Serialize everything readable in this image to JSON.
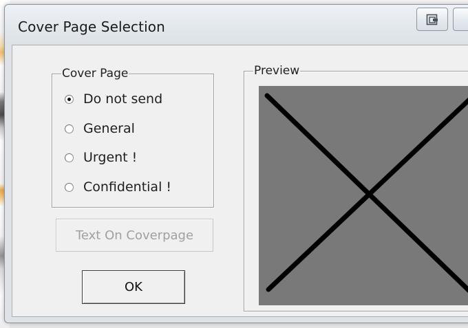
{
  "window": {
    "title": "Cover Page Selection",
    "titlebar_buttons": [
      {
        "icon": "restore-icon"
      },
      {
        "icon": "maximize-icon"
      }
    ]
  },
  "cover_page": {
    "legend": "Cover Page",
    "options": [
      {
        "label": "Do not send",
        "checked": true
      },
      {
        "label": "General",
        "checked": false
      },
      {
        "label": "Urgent !",
        "checked": false
      },
      {
        "label": "Confidential !",
        "checked": false
      }
    ]
  },
  "buttons": {
    "text_on_coverpage": "Text On Coverpage",
    "text_on_coverpage_enabled": false,
    "ok": "OK"
  },
  "preview": {
    "legend": "Preview",
    "placeholder_icon": "no-preview-x-icon",
    "background_color": "#7a7979",
    "mark_color": "#000000"
  }
}
